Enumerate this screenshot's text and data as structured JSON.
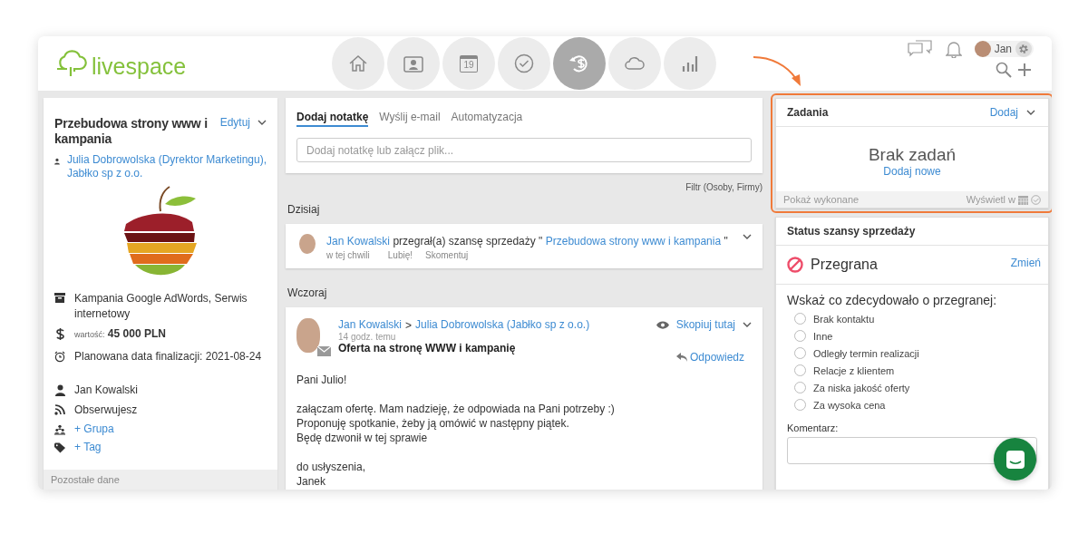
{
  "header": {
    "logo": "livespace",
    "nav": [
      {
        "kind": "home",
        "selected": false
      },
      {
        "kind": "contacts",
        "selected": false
      },
      {
        "kind": "calendar",
        "label": "19",
        "selected": false
      },
      {
        "kind": "tasks",
        "selected": false
      },
      {
        "kind": "deals",
        "selected": true
      },
      {
        "kind": "cloud",
        "selected": false
      },
      {
        "kind": "reports",
        "selected": false
      }
    ],
    "user": {
      "name": "Jan"
    }
  },
  "deal": {
    "title": "Przebudowa strony www i kampania",
    "edit": "Edytuj",
    "contacts": [
      "Julia Dobrowolska (Dyrektor Marketingu),",
      "Jabłko sp z o.o."
    ],
    "details": [
      {
        "kind": "campaign",
        "text": "Kampania Google AdWords, Serwis internetowy"
      },
      {
        "kind": "value",
        "label": "wartość:",
        "text": "45 000 PLN"
      },
      {
        "kind": "date",
        "text": "Planowana data finalizacji: 2021-08-24"
      },
      {
        "kind": "owner",
        "text": "Jan Kowalski"
      },
      {
        "kind": "follow",
        "text": "Obserwujesz"
      },
      {
        "kind": "group",
        "text": "+ Grupa"
      },
      {
        "kind": "tag",
        "text": "+ Tag"
      }
    ],
    "footer": "Pozostałe dane"
  },
  "composer": {
    "tabs": [
      {
        "label": "Dodaj notatkę",
        "selected": true
      },
      {
        "label": "Wyślij e-mail",
        "selected": false
      },
      {
        "label": "Automatyzacja",
        "selected": false
      }
    ],
    "placeholder": "Dodaj notatkę lub załącz plik..."
  },
  "filter": "Filtr (Osoby, Firmy)",
  "today": {
    "heading": "Dzisiaj",
    "actor": "Jan Kowalski",
    "action": "przegrał(a) szansę sprzedaży \"",
    "target": "Przebudowa strony www i kampania",
    "end": "\"",
    "time": "w tej chwili",
    "like": "Lubię!",
    "comment": "Skomentuj"
  },
  "yesterday": {
    "heading": "Wczoraj",
    "from": "Jan Kowalski",
    "separator": ">",
    "to": "Julia Dobrowolska (Jabłko sp z o.o.)",
    "time": "14 godz. temu",
    "subject": "Oferta na stronę WWW i kampanię",
    "copy": "Skopiuj tutaj",
    "reply": "Odpowiedz",
    "body": [
      [
        "Pani Julio!"
      ],
      [
        "załączam ofertę. Mam nadzieję, że odpowiada na Pani potrzeby :)",
        "Proponuję spotkanie, żeby ją omówić w następny piątek.",
        "Będę dzwonił w tej sprawie"
      ],
      [
        "do usłyszenia,",
        "Janek"
      ]
    ]
  },
  "tasks": {
    "title": "Zadania",
    "add": "Dodaj",
    "empty": "Brak zadań",
    "add_new": "Dodaj nowe",
    "show_done": "Pokaż wykonane",
    "view_in": "Wyświetl w"
  },
  "status": {
    "title": "Status szansy sprzedaży",
    "value": "Przegrana",
    "change": "Zmień",
    "question": "Wskaż co zdecydowało o przegranej:",
    "reasons": [
      {
        "label": "Brak kontaktu",
        "selected": false
      },
      {
        "label": "Inne",
        "selected": false
      },
      {
        "label": "Odległy termin realizacji",
        "selected": false
      },
      {
        "label": "Relacje z klientem",
        "selected": false
      },
      {
        "label": "Za niska jakość oferty",
        "selected": false
      },
      {
        "label": "Za wysoka cena",
        "selected": false
      }
    ],
    "comment_label": "Komentarz:"
  }
}
